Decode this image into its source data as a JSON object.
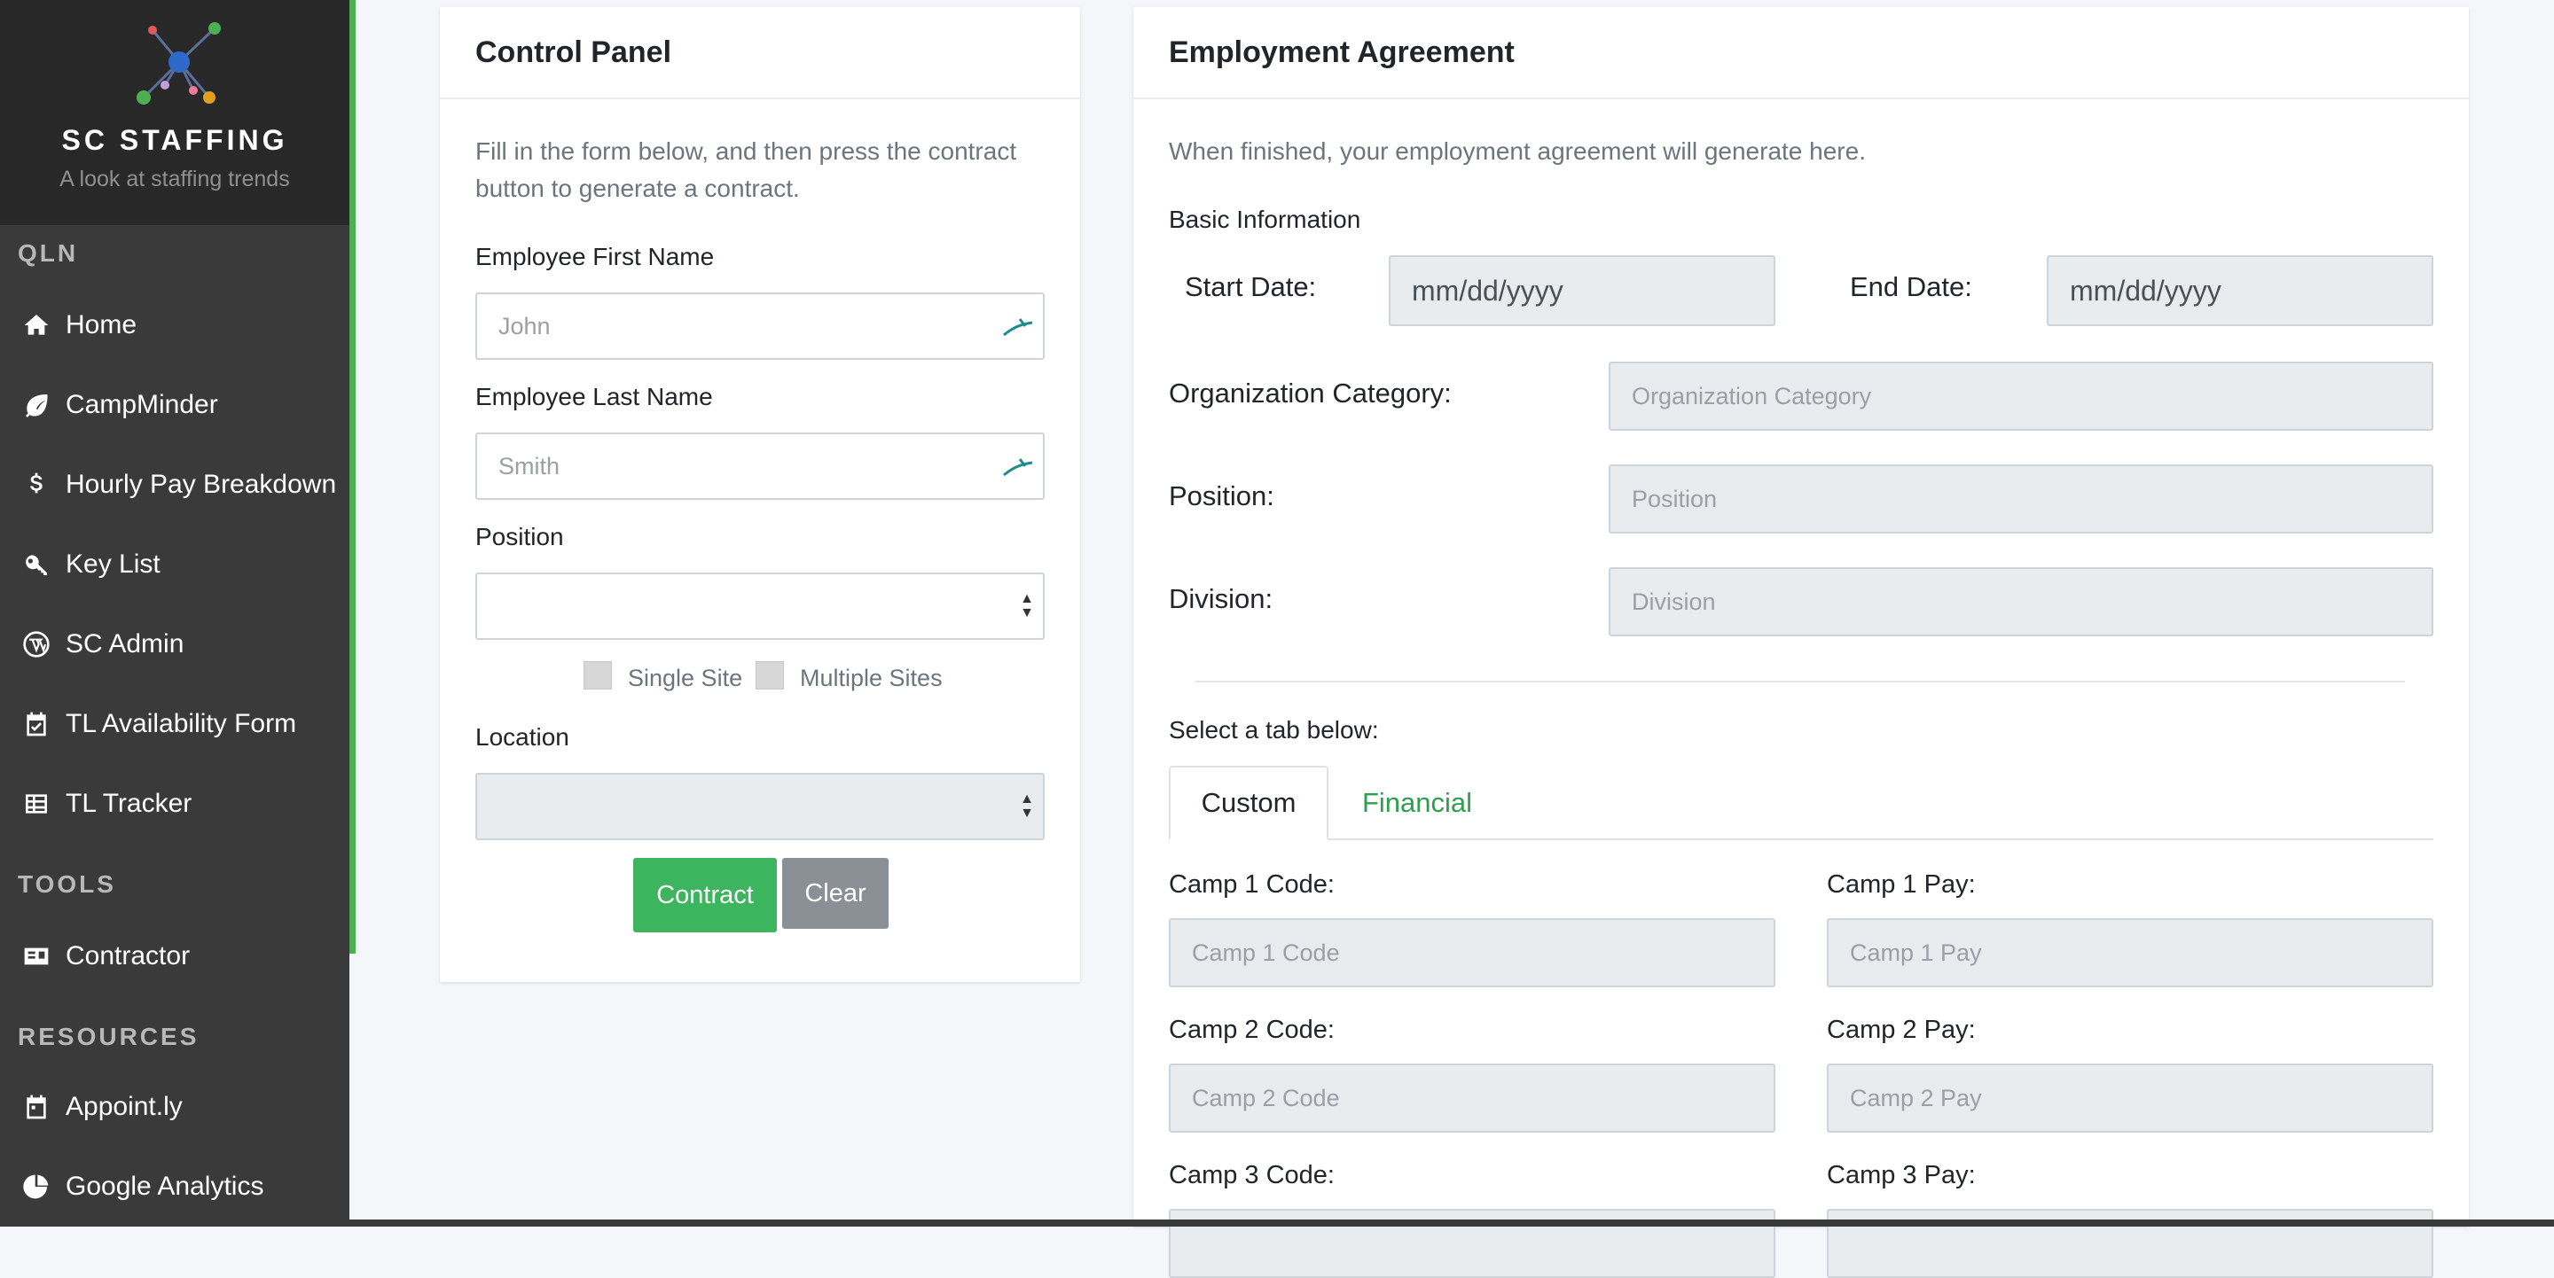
{
  "brand": {
    "title": "SC STAFFING",
    "subtitle": "A look at staffing trends",
    "accent_color": "#4caf50"
  },
  "sidebar": {
    "sections": [
      {
        "title": "QLN"
      },
      {
        "title": "TOOLS"
      },
      {
        "title": "RESOURCES"
      }
    ],
    "items": [
      {
        "label": "Home",
        "icon": "home-icon"
      },
      {
        "label": "CampMinder",
        "icon": "leaf-icon"
      },
      {
        "label": "Hourly Pay Breakdown",
        "icon": "dollar-icon"
      },
      {
        "label": "Key List",
        "icon": "key-icon"
      },
      {
        "label": "SC Admin",
        "icon": "wordpress-icon"
      },
      {
        "label": "TL Availability Form",
        "icon": "calendar-check-icon"
      },
      {
        "label": "TL Tracker",
        "icon": "table-icon"
      },
      {
        "label": "Contractor",
        "icon": "id-card-icon"
      },
      {
        "label": "Appoint.ly",
        "icon": "calendar-icon"
      },
      {
        "label": "Google Analytics",
        "icon": "pie-chart-icon"
      }
    ]
  },
  "control_panel": {
    "title": "Control Panel",
    "intro": "Fill in the form below, and then press the contract button to generate a contract.",
    "first_name_label": "Employee First Name",
    "first_name_placeholder": "John",
    "last_name_label": "Employee Last Name",
    "last_name_placeholder": "Smith",
    "position_label": "Position",
    "position_value": "",
    "single_site_label": "Single Site",
    "multiple_sites_label": "Multiple Sites",
    "location_label": "Location",
    "location_value": "",
    "contract_button": "Contract",
    "clear_button": "Clear",
    "contract_color": "#3cb55e",
    "clear_color": "#8a9096"
  },
  "agreement": {
    "title": "Employment Agreement",
    "intro": "When finished, your employment agreement will generate here.",
    "basic_info_label": "Basic Information",
    "start_date_label": "Start Date:",
    "start_date_placeholder": "mm/dd/yyyy",
    "end_date_label": "End Date:",
    "end_date_placeholder": "mm/dd/yyyy",
    "org_category_label": "Organization Category:",
    "org_category_placeholder": "Organization Category",
    "position_label": "Position:",
    "position_placeholder": "Position",
    "division_label": "Division:",
    "division_placeholder": "Division",
    "select_tab_label": "Select a tab below:",
    "tabs": [
      {
        "label": "Custom",
        "active": true
      },
      {
        "label": "Financial",
        "active": false
      }
    ],
    "camps": [
      {
        "code_label": "Camp 1 Code:",
        "code_placeholder": "Camp 1 Code",
        "pay_label": "Camp 1 Pay:",
        "pay_placeholder": "Camp 1 Pay"
      },
      {
        "code_label": "Camp 2 Code:",
        "code_placeholder": "Camp 2 Code",
        "pay_label": "Camp 2 Pay:",
        "pay_placeholder": "Camp 2 Pay"
      },
      {
        "code_label": "Camp 3 Code:",
        "code_placeholder": "",
        "pay_label": "Camp 3 Pay:",
        "pay_placeholder": ""
      }
    ],
    "tab_active_color": "#212529",
    "tab_link_color": "#2e9e4f"
  }
}
